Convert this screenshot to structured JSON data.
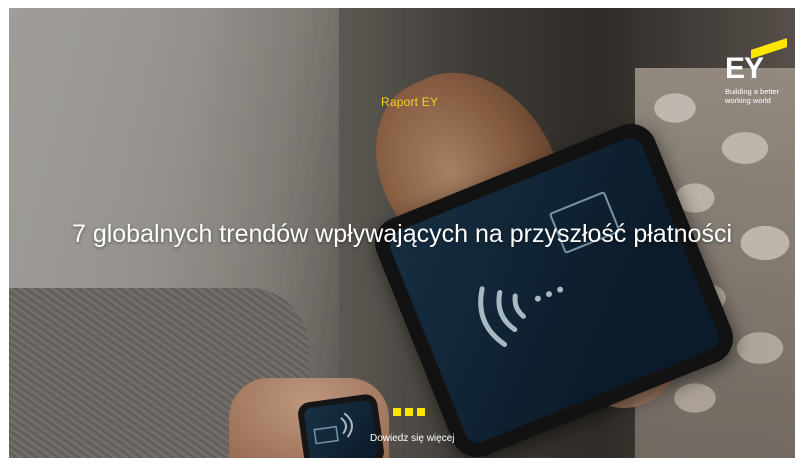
{
  "brand": {
    "mark": "EY",
    "tagline_line1": "Building a better",
    "tagline_line2": "working world",
    "accent_color": "#ffe600"
  },
  "hero": {
    "report_label": "Raport EY",
    "headline": "7 globalnych trendów wpływających na przyszłość płatności",
    "cta_label": "Dowiedz się więcej",
    "cta_icon": "three-dots-indicator"
  },
  "colors": {
    "report_label": "#f5d21c",
    "headline": "#ffffff"
  }
}
